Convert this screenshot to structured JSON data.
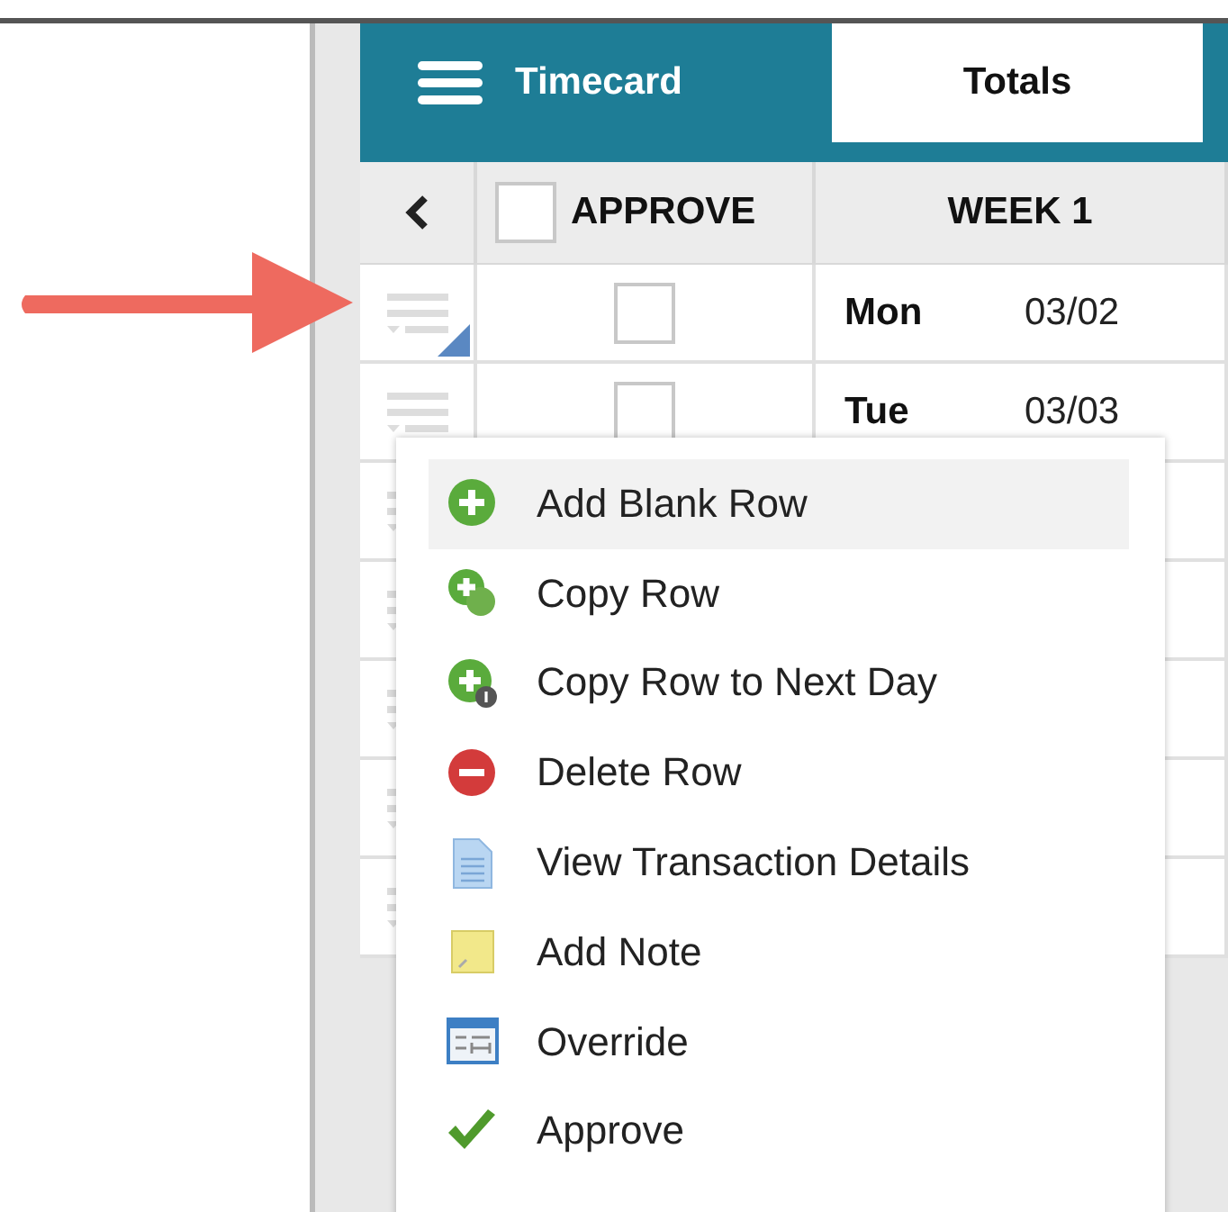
{
  "header": {
    "tabs": [
      {
        "label": "Timecard",
        "selected": true,
        "kind": "menu"
      },
      {
        "label": "Totals",
        "selected": false,
        "kind": "plain"
      }
    ]
  },
  "table": {
    "columns": [
      "APPROVE",
      "WEEK 1"
    ],
    "select_all_checked": false,
    "rows": [
      {
        "day": "Mon",
        "date": "03/02",
        "checked": false,
        "flagged": true
      },
      {
        "day": "Tue",
        "date": "03/03",
        "checked": false,
        "flagged": false
      }
    ]
  },
  "context_menu": {
    "items": [
      {
        "label": "Add Blank Row",
        "kind": "add",
        "highlighted": true
      },
      {
        "label": "Copy Row",
        "kind": "copy",
        "highlighted": false
      },
      {
        "label": "Copy Row to Next Day",
        "kind": "copy-next",
        "highlighted": false
      },
      {
        "label": "Delete Row",
        "kind": "delete",
        "highlighted": false
      },
      {
        "label": "View Transaction Details",
        "kind": "details",
        "highlighted": false
      },
      {
        "label": "Add Note",
        "kind": "note",
        "highlighted": false
      },
      {
        "label": "Override",
        "kind": "override",
        "highlighted": false
      },
      {
        "label": "Approve",
        "kind": "approve",
        "highlighted": false
      }
    ]
  }
}
